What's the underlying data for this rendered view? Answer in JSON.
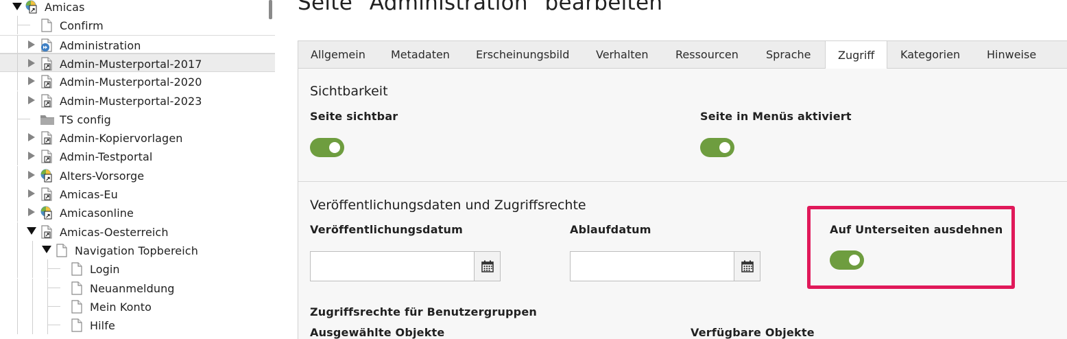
{
  "tree": {
    "nodes": [
      {
        "label": "Amicas",
        "toggle": "expanded",
        "icon": "page-globe-shortcut-icon"
      },
      {
        "label": "Confirm",
        "toggle": "none",
        "icon": "page-icon"
      },
      {
        "label": "Administration",
        "toggle": "collapsed",
        "icon": "page-forward-icon",
        "state": "selected"
      },
      {
        "label": "Admin-Musterportal-2017",
        "toggle": "collapsed",
        "icon": "page-shortcut-icon",
        "state": "hover"
      },
      {
        "label": "Admin-Musterportal-2020",
        "toggle": "collapsed",
        "icon": "page-shortcut-icon"
      },
      {
        "label": "Admin-Musterportal-2023",
        "toggle": "collapsed",
        "icon": "page-shortcut-icon"
      },
      {
        "label": "TS config",
        "toggle": "none",
        "icon": "folder-icon"
      },
      {
        "label": "Admin-Kopiervorlagen",
        "toggle": "collapsed",
        "icon": "page-shortcut-icon"
      },
      {
        "label": "Admin-Testportal",
        "toggle": "collapsed",
        "icon": "page-shortcut-icon"
      },
      {
        "label": "Alters-Vorsorge",
        "toggle": "collapsed",
        "icon": "page-globe-shortcut-icon"
      },
      {
        "label": "Amicas-Eu",
        "toggle": "collapsed",
        "icon": "page-shortcut-icon"
      },
      {
        "label": "Amicasonline",
        "toggle": "collapsed",
        "icon": "page-globe-shortcut-icon"
      },
      {
        "label": "Amicas-Oesterreich",
        "toggle": "expanded",
        "icon": "page-shortcut-icon"
      },
      {
        "label": "Navigation Topbereich",
        "toggle": "expanded",
        "icon": "page-icon"
      },
      {
        "label": "Login",
        "toggle": "none",
        "icon": "page-icon"
      },
      {
        "label": "Neuanmeldung",
        "toggle": "none",
        "icon": "page-icon"
      },
      {
        "label": "Mein Konto",
        "toggle": "none",
        "icon": "page-icon"
      },
      {
        "label": "Hilfe",
        "toggle": "none",
        "icon": "page-icon"
      }
    ]
  },
  "main": {
    "title": "Seite \"Administration\" bearbeiten",
    "tabs": [
      {
        "label": "Allgemein"
      },
      {
        "label": "Metadaten"
      },
      {
        "label": "Erscheinungsbild"
      },
      {
        "label": "Verhalten"
      },
      {
        "label": "Ressourcen"
      },
      {
        "label": "Sprache"
      },
      {
        "label": "Zugriff",
        "active": true
      },
      {
        "label": "Kategorien"
      },
      {
        "label": "Hinweise"
      }
    ],
    "visibility": {
      "title": "Sichtbarkeit",
      "page_visible": {
        "label": "Seite sichtbar",
        "on": true
      },
      "in_menus": {
        "label": "Seite in Menüs aktiviert",
        "on": true
      }
    },
    "publishing": {
      "title": "Veröffentlichungsdaten und Zugriffsrechte",
      "start_date": {
        "label": "Veröffentlichungsdatum",
        "value": "",
        "icon": "calendar-icon"
      },
      "end_date": {
        "label": "Ablaufdatum",
        "value": "",
        "icon": "calendar-icon"
      },
      "extend_to_subpages": {
        "label": "Auf Unterseiten ausdehnen",
        "on": true
      },
      "access_groups_label": "Zugriffsrechte für Benutzergruppen",
      "selected_items_label": "Ausgewählte Objekte",
      "available_items_label": "Verfügbare Objekte"
    }
  },
  "colors": {
    "switch_on": "#6e9d3f",
    "highlight": "#e0195a",
    "tab_bar": "#ededed",
    "panel": "#f7f7f7"
  }
}
